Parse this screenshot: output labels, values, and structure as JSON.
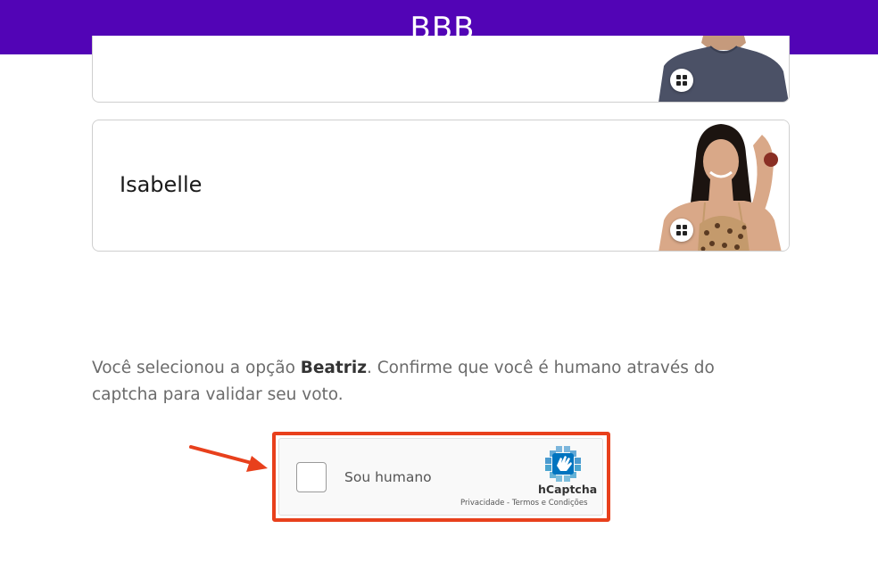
{
  "header": {
    "title": "BBB"
  },
  "candidates": [
    {
      "name": ""
    },
    {
      "name": "Isabelle"
    }
  ],
  "prompt": {
    "before": "Você selecionou a opção ",
    "selected": "Beatriz",
    "after": ". Confirme que você é humano através do captcha para validar seu voto."
  },
  "captcha": {
    "checkbox_label": "Sou humano",
    "brand": "hCaptcha",
    "privacy_link": "Privacidade",
    "separator": " - ",
    "terms_link": "Termos e Condições"
  },
  "icons": [
    "zoom-grid-icon",
    "hcaptcha-logo-icon",
    "annotation-arrow"
  ],
  "colors": {
    "header_bg": "#5204b6",
    "highlight_outline": "#e8401c",
    "hcaptcha_blue": "#0074bf"
  }
}
